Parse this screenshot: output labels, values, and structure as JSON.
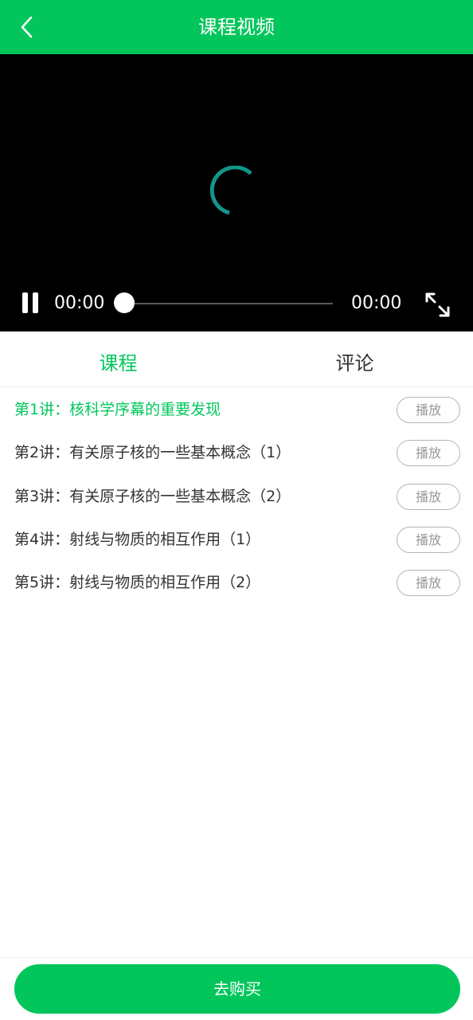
{
  "header": {
    "title": "课程视频",
    "back_icon": "chevron-left-icon",
    "background_color": "#02c65b"
  },
  "video": {
    "state": "loading",
    "spinner_color": "#12958a",
    "current_time": "00:00",
    "total_time": "00:00",
    "progress": 0,
    "play_state_icon": "pause-icon",
    "fullscreen_icon": "expand-icon"
  },
  "tabs": [
    {
      "label": "课程",
      "active": true
    },
    {
      "label": "评论",
      "active": false
    }
  ],
  "lessons": [
    {
      "title": "第1讲：核科学序幕的重要发现",
      "button": "播放",
      "active": true
    },
    {
      "title": "第2讲：有关原子核的一些基本概念（1）",
      "button": "播放",
      "active": false
    },
    {
      "title": "第3讲：有关原子核的一些基本概念（2）",
      "button": "播放",
      "active": false
    },
    {
      "title": "第4讲：射线与物质的相互作用（1）",
      "button": "播放",
      "active": false
    },
    {
      "title": "第5讲：射线与物质的相互作用（2）",
      "button": "播放",
      "active": false
    }
  ],
  "footer": {
    "buy_label": "去购买"
  },
  "colors": {
    "accent": "#02c65b",
    "text": "#333333",
    "muted": "#999999"
  }
}
